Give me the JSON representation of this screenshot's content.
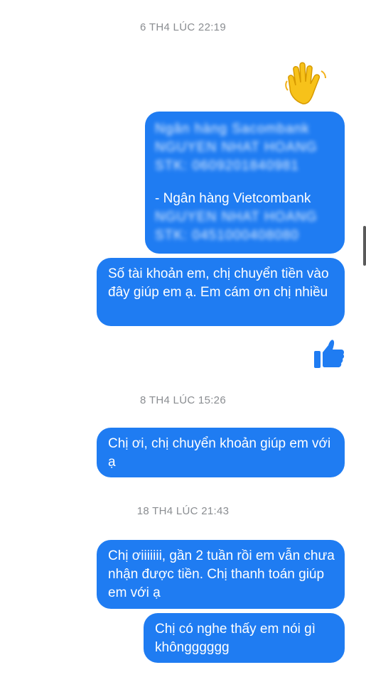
{
  "conversation": {
    "timestamps": [
      "6 TH4 LÚC 22:19",
      "8 TH4 LÚC 15:26",
      "18 TH4 LÚC 21:43"
    ],
    "messages": {
      "account_card": {
        "blurred_top": [
          "Ngân hàng Sacombank",
          "NGUYEN NHAT HOANG",
          "STK: 0609201840981"
        ],
        "bank_line": "- Ngân hàng Vietcombank",
        "blurred_bottom": [
          "NGUYEN NHAT HOANG",
          "STK: 0451000408080"
        ]
      },
      "m1": "Số tài khoản em, chị chuyển tiền vào đây giúp em ạ. Em cám ơn chị nhiều",
      "m2": "Chị ơi, chị chuyển khoản giúp em với ạ",
      "m3": "Chị ơiiiiiii, gần 2 tuần rồi em vẫn chưa nhận được tiền. Chị thanh toán giúp em với ạ",
      "m4": "Chị có nghe thấy em nói gì khôngggggg"
    },
    "reactions": {
      "wave": "waving-hand-emoji",
      "like": "thumbs-up-icon"
    },
    "colors": {
      "bubble": "#1f7cf2",
      "timestamp": "#8a8d91"
    }
  }
}
